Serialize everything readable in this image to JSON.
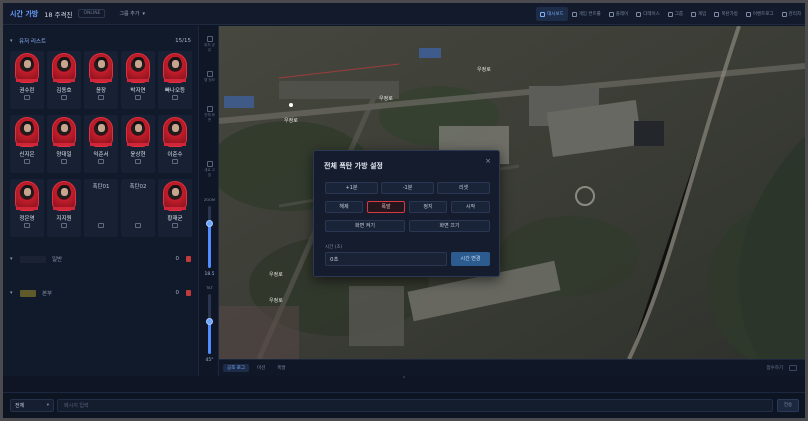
{
  "topbar": {
    "brand": "시간 가방",
    "subtitle": "18 주격진",
    "chip": "ONLINE",
    "group_add": "그룹 추가",
    "nav": [
      {
        "label": "대시보드",
        "icon": "grid-icon",
        "active": true
      },
      {
        "label": "게임 컨트롤",
        "icon": "gamepad-icon",
        "active": false
      },
      {
        "label": "플레이",
        "icon": "play-icon",
        "active": false
      },
      {
        "label": "다레이스",
        "icon": "map-icon",
        "active": false
      },
      {
        "label": "그룹",
        "icon": "group-icon",
        "active": false
      },
      {
        "label": "게임",
        "icon": "circle-icon",
        "active": false
      },
      {
        "label": "폭탄가방",
        "icon": "bomb-icon",
        "active": false
      },
      {
        "label": "이벤트로그",
        "icon": "log-icon",
        "active": false
      },
      {
        "label": "관리자",
        "icon": "settings-icon",
        "active": false
      }
    ]
  },
  "player_section": {
    "title": "유저 리스트",
    "count": "15/15",
    "players": [
      {
        "name": "권수린",
        "type": "avatar"
      },
      {
        "name": "김동호",
        "type": "avatar"
      },
      {
        "name": "윤장",
        "type": "avatar"
      },
      {
        "name": "박지연",
        "type": "avatar"
      },
      {
        "name": "빠나오등",
        "type": "avatar"
      },
      {
        "name": "신지은",
        "type": "avatar"
      },
      {
        "name": "양대일",
        "type": "avatar"
      },
      {
        "name": "익준서",
        "type": "avatar"
      },
      {
        "name": "윤상현",
        "type": "avatar"
      },
      {
        "name": "이준수",
        "type": "avatar"
      },
      {
        "name": "정은영",
        "type": "avatar"
      },
      {
        "name": "지지원",
        "type": "avatar"
      },
      {
        "name": "폭탄01",
        "type": "empty"
      },
      {
        "name": "폭탄02",
        "type": "empty"
      },
      {
        "name": "황재균",
        "type": "avatar"
      }
    ]
  },
  "groups": [
    {
      "name": "일반",
      "count": "0"
    },
    {
      "name": "본부",
      "count": "0"
    }
  ],
  "vstrip": {
    "buttons": [
      "위치 공유",
      "맵 정보",
      "전체 화면",
      "새로 고침"
    ],
    "zoom_label": "ZOOM",
    "zoom_value": "18.5",
    "zoom_fraction": 0.72,
    "tilt_label": "TILT",
    "tilt_value": "45°",
    "tilt_fraction": 0.55
  },
  "map_labels": [
    "우정로",
    "우정로",
    "우정로",
    "우정로",
    "우정로"
  ],
  "log": {
    "tabs": [
      {
        "label": "공조 로그",
        "active": true
      },
      {
        "label": "미션",
        "active": false
      },
      {
        "label": "폭발",
        "active": false
      }
    ],
    "right": "접수하기"
  },
  "bottom": {
    "target": "전체",
    "message_placeholder": "메시지 입력",
    "send": "전송"
  },
  "modal": {
    "title": "전체 폭탄 가방 설정",
    "close": "×",
    "row1": [
      "+1분",
      "-1분",
      "리셋"
    ],
    "row2": [
      "해제",
      "폭발",
      "정지",
      "시작"
    ],
    "row3": [
      "화면 켜기",
      "화면 끄기"
    ],
    "time_label": "시간 (초)",
    "time_value": "0초",
    "time_button": "시간 변경"
  },
  "colors": {
    "accent": "#4f8cff",
    "danger": "#d8383f",
    "background": "#0f1524"
  }
}
